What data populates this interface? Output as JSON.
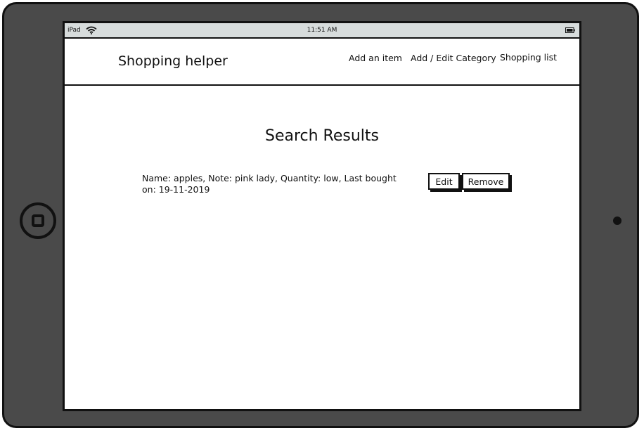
{
  "statusbar": {
    "device": "iPad",
    "time": "11:51 AM",
    "wifi_icon": "wifi-icon",
    "battery_icon": "battery-icon"
  },
  "header": {
    "brand": "Shopping helper",
    "nav": {
      "add_item": "Add an item",
      "edit_category": "Add / Edit Category",
      "shopping_list": "Shopping list"
    }
  },
  "main": {
    "title": "Search Results",
    "results": [
      {
        "text": "Name: apples, Note: pink lady, Quantity: low, Last bought on: 19-11-2019",
        "edit_label": "Edit",
        "remove_label": "Remove"
      }
    ]
  },
  "device": {
    "home_button_icon": "home-button-icon",
    "camera_icon": "camera-icon"
  }
}
